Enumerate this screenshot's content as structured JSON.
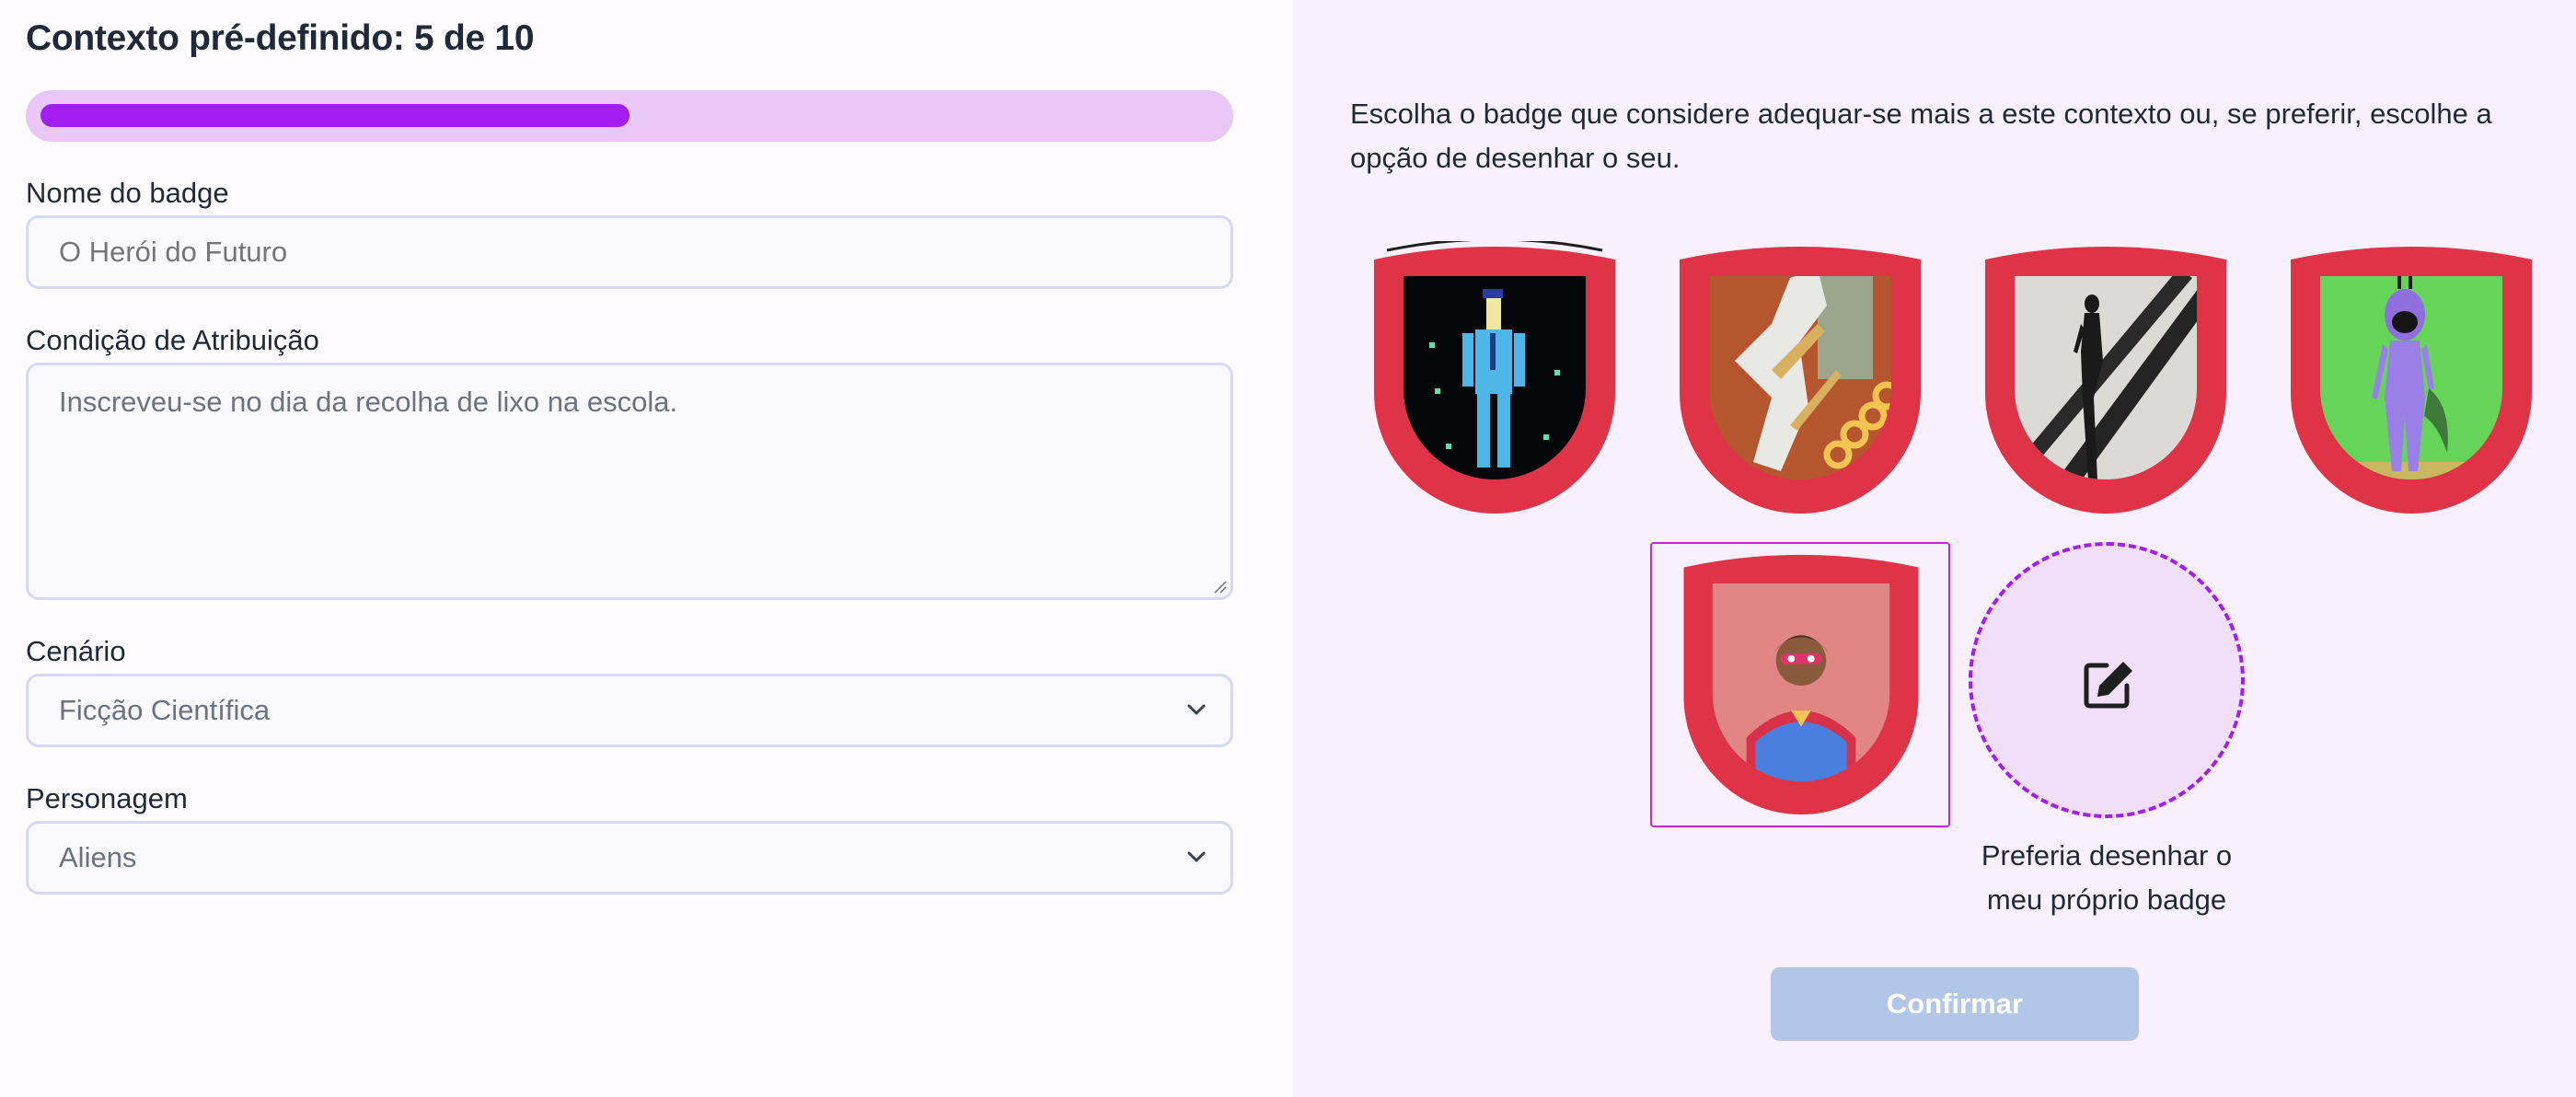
{
  "form": {
    "title": "Contexto pré-definido: 5 de 10",
    "progress": {
      "current": 5,
      "total": 10,
      "fraction": 0.5
    },
    "badge_name": {
      "label": "Nome do badge",
      "placeholder": "O Herói do Futuro"
    },
    "condition": {
      "label": "Condição de Atribuição",
      "placeholder": "Inscreveu-se no dia da recolha de lixo na escola."
    },
    "scenario": {
      "label": "Cenário",
      "selected": "Ficção Científica"
    },
    "character": {
      "label": "Personagem",
      "selected": "Aliens"
    }
  },
  "picker": {
    "intro": "Escolha o badge que considere adequar-se mais a este contexto ou, se preferir, escolhe a opção de desenhar o seu.",
    "badges": [
      {
        "name": "pixel-agent",
        "selected": false
      },
      {
        "name": "robot-warrior",
        "selected": false
      },
      {
        "name": "silhouette-figure",
        "selected": false
      },
      {
        "name": "purple-alien",
        "selected": false
      },
      {
        "name": "superhero",
        "selected": true
      }
    ],
    "draw_option": {
      "label": "Preferia desenhar o meu próprio badge",
      "icon": "edit-icon"
    },
    "confirm_label": "Confirmar"
  },
  "colors": {
    "accent": "#a21ef0",
    "badge_border": "#df3347",
    "confirm_disabled": "#b2c6e8"
  }
}
